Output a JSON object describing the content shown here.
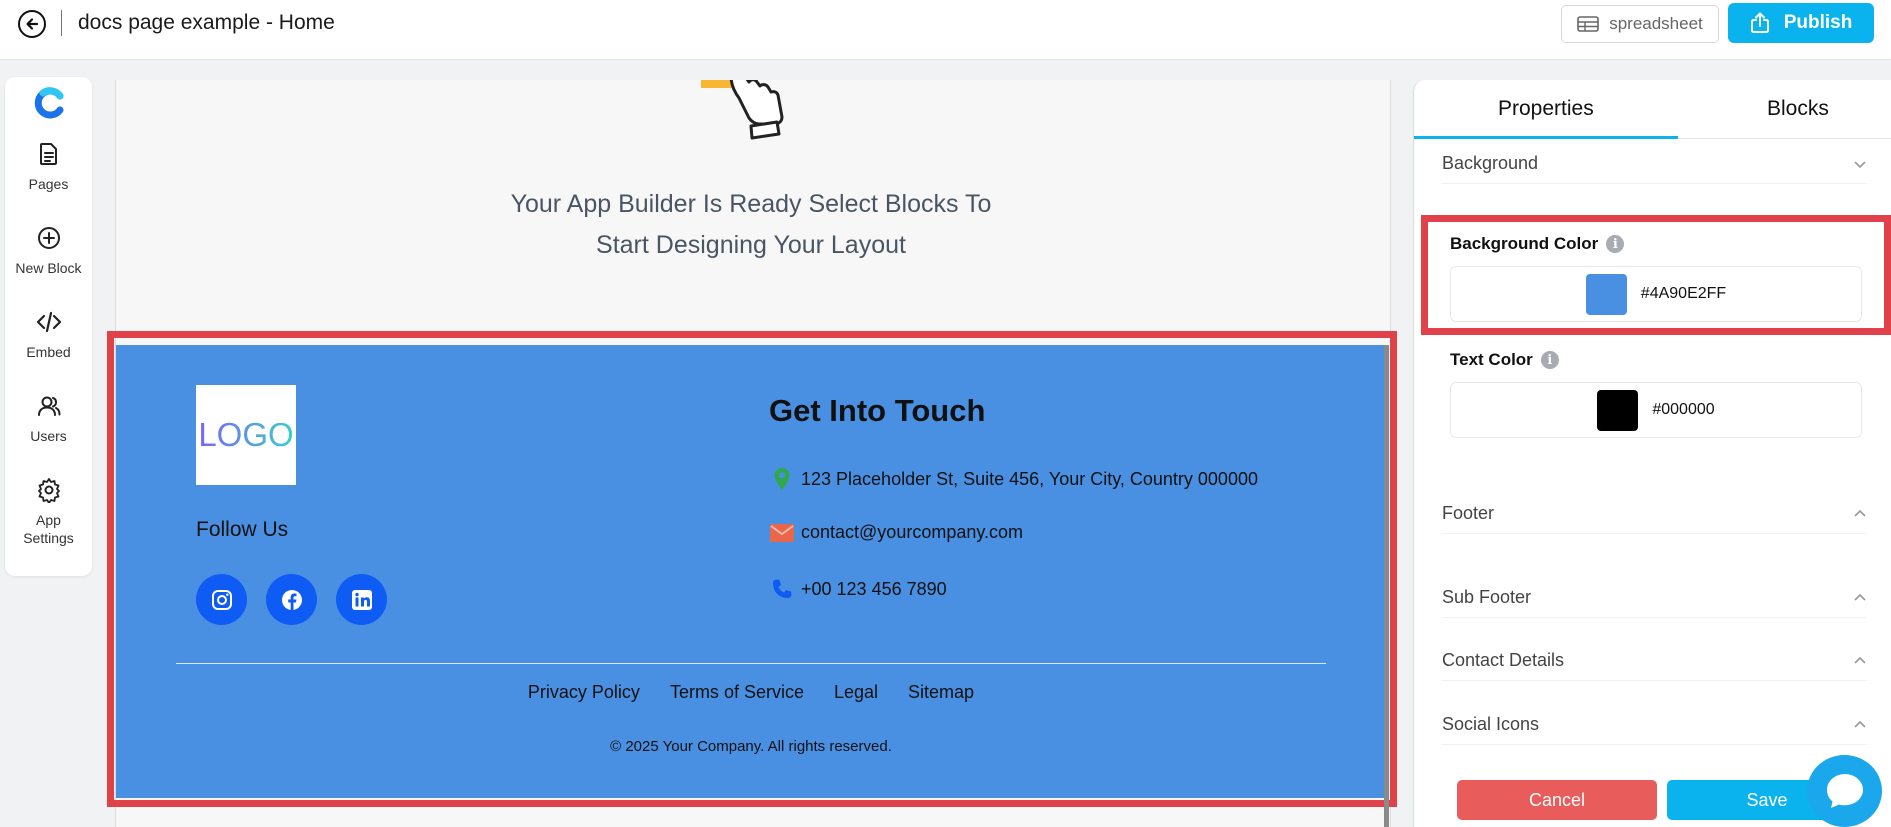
{
  "header": {
    "title": "docs page example - Home",
    "spreadsheet_label": "spreadsheet",
    "publish_label": "Publish"
  },
  "sidebar": {
    "items": [
      {
        "label": "Pages",
        "icon": "document-icon"
      },
      {
        "label": "New Block",
        "icon": "plus-circle-icon"
      },
      {
        "label": "Embed",
        "icon": "code-icon"
      },
      {
        "label": "Users",
        "icon": "users-icon"
      },
      {
        "label": "App Settings",
        "icon": "gear-icon"
      }
    ]
  },
  "canvas": {
    "hero_line1": "Your App Builder Is Ready Select Blocks To",
    "hero_line2": "Start Designing Your Layout",
    "footer": {
      "logo_text": "LOGO",
      "follow_title": "Follow Us",
      "contact_title": "Get Into Touch",
      "address": "123 Placeholder St, Suite 456, Your City, Country 000000",
      "email": "contact@yourcompany.com",
      "phone": "+00 123 456 7890",
      "links": [
        "Privacy Policy",
        "Terms of Service",
        "Legal",
        "Sitemap"
      ],
      "copyright": "© 2025 Your Company. All rights reserved.",
      "bg_color": "#4a90e2"
    }
  },
  "panel": {
    "tabs": [
      "Properties",
      "Blocks"
    ],
    "sections": {
      "background": "Background",
      "footer": "Footer",
      "sub_footer": "Sub Footer",
      "contact_details": "Contact Details",
      "social_icons": "Social Icons"
    },
    "background_color_label": "Background Color",
    "background_color_value": "#4A90E2FF",
    "text_color_label": "Text Color",
    "text_color_value": "#000000",
    "cancel_label": "Cancel",
    "save_label": "Save"
  },
  "colors": {
    "accent": "#0ab3ee",
    "highlight": "#e14148",
    "cancel": "#e85d5b"
  }
}
